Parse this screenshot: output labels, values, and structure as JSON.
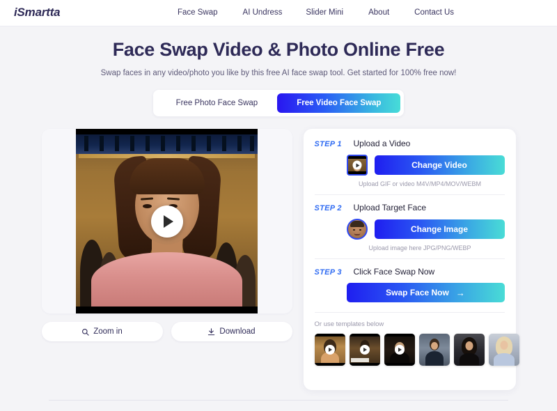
{
  "header": {
    "logo": "iSmartta",
    "nav": [
      {
        "label": "Face Swap"
      },
      {
        "label": "AI Undress"
      },
      {
        "label": "Slider Mini"
      },
      {
        "label": "About"
      },
      {
        "label": "Contact Us"
      }
    ]
  },
  "hero": {
    "title": "Face Swap Video & Photo Online Free",
    "subtitle": "Swap faces in any video/photo you like by this free AI face swap tool. Get started for 100% free now!"
  },
  "tabs": {
    "photo": "Free Photo Face Swap",
    "video": "Free Video Face Swap",
    "active": "video"
  },
  "preview": {
    "play_icon": "play-icon",
    "zoom_in": "Zoom in",
    "zoom_icon": "search-icon",
    "download": "Download",
    "download_icon": "download-icon"
  },
  "steps": [
    {
      "number": "STEP 1",
      "title": "Upload a Video",
      "button": "Change Video",
      "hint": "Upload GIF or video M4V/MP4/MOV/WEBM",
      "thumb_icon": "video-thumbnail"
    },
    {
      "number": "STEP 2",
      "title": "Upload Target Face",
      "button": "Change Image",
      "hint": "Upload image here JPG/PNG/WEBP",
      "thumb_icon": "face-avatar"
    },
    {
      "number": "STEP 3",
      "title": "Click Face Swap Now",
      "button": "Swap Face Now",
      "arrow": "→"
    }
  ],
  "templates": {
    "label": "Or use templates below",
    "items": [
      {
        "name": "template-1",
        "has_play": true
      },
      {
        "name": "template-2",
        "has_play": true
      },
      {
        "name": "template-3",
        "has_play": true
      },
      {
        "name": "template-4",
        "has_play": false
      },
      {
        "name": "template-5",
        "has_play": false
      },
      {
        "name": "template-6",
        "has_play": false
      }
    ]
  },
  "colors": {
    "brand_dark": "#2e2a57",
    "gradient_start": "#1f1ef0",
    "gradient_end": "#49dcd6",
    "step_blue": "#2f6bf2",
    "page_bg": "#f4f4f7"
  }
}
